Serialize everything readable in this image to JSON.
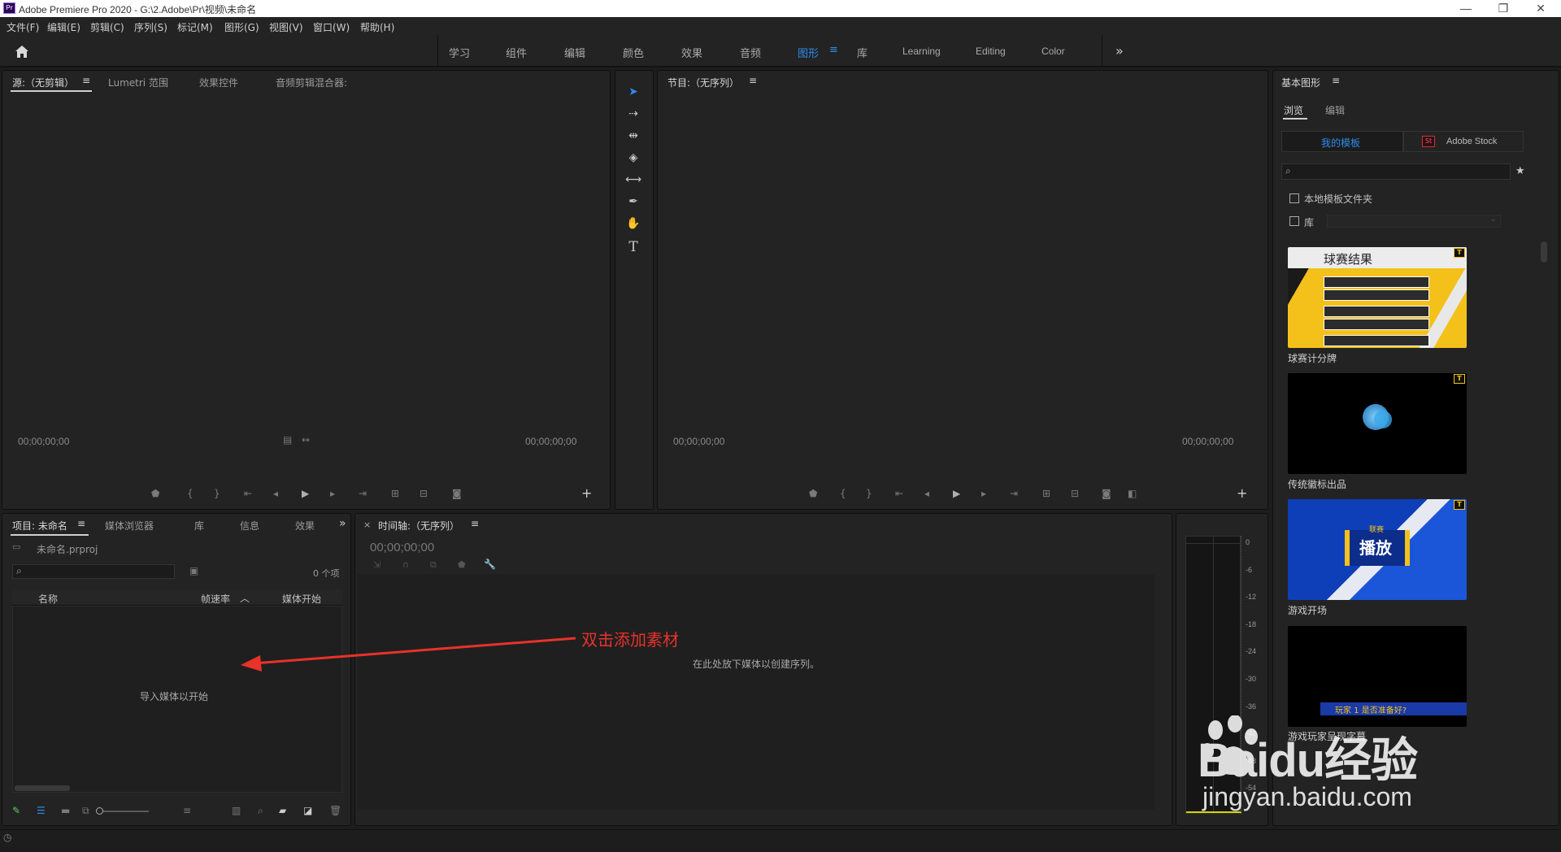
{
  "app": {
    "logo_text": "Pr",
    "title": "Adobe Premiere Pro 2020 - G:\\2.Adobe\\Pr\\视频\\未命名"
  },
  "window_controls": {
    "minimize": "—",
    "restore": "❐",
    "close": "✕"
  },
  "menu": [
    "文件(F)",
    "编辑(E)",
    "剪辑(C)",
    "序列(S)",
    "标记(M)",
    "图形(G)",
    "视图(V)",
    "窗口(W)",
    "帮助(H)"
  ],
  "workspaces": {
    "items": [
      "学习",
      "组件",
      "编辑",
      "颜色",
      "效果",
      "音频",
      "图形",
      "库",
      "Learning",
      "Editing",
      "Color"
    ],
    "active": "图形",
    "overflow": "»"
  },
  "source_panel": {
    "tabs": [
      "源:（无剪辑）",
      "Lumetri 范围",
      "效果控件",
      "音频剪辑混合器:"
    ],
    "timecode_left": "00;00;00;00",
    "timecode_right": "00;00;00;00"
  },
  "program_panel": {
    "title": "节目:（无序列）",
    "timecode_left": "00;00;00;00",
    "timecode_right": "00;00;00;00"
  },
  "tools": [
    "selection-tool",
    "track-select-tool",
    "ripple-edit-tool",
    "razor-tool",
    "slip-tool",
    "pen-tool",
    "hand-tool",
    "type-tool"
  ],
  "project_panel": {
    "tabs": [
      "项目: 未命名",
      "媒体浏览器",
      "库",
      "信息",
      "效果"
    ],
    "file": "未命名.prproj",
    "item_count": "0 个项",
    "columns": [
      "名称",
      "帧速率",
      "媒体开始"
    ],
    "empty_message": "导入媒体以开始"
  },
  "timeline_panel": {
    "title": "时间轴:（无序列）",
    "timecode": "00;00;00;00",
    "empty_message": "在此处放下媒体以创建序列。"
  },
  "annotation": {
    "text": "双击添加素材",
    "color": "#e8322a"
  },
  "meter": {
    "labels": [
      "0",
      "-6",
      "-12",
      "-18",
      "-24",
      "-30",
      "-36",
      "-42",
      "-48",
      "-54"
    ]
  },
  "graphics_panel": {
    "title": "基本图形",
    "tabs": [
      "浏览",
      "编辑"
    ],
    "subtabs": [
      "我的模板",
      "Adobe Stock"
    ],
    "stock_badge": "St",
    "checkbox_local": "本地模板文件夹",
    "checkbox_lib": "库",
    "templates": [
      {
        "label": "球赛计分牌",
        "thumb_title": "球赛结果"
      },
      {
        "label": "传统徽标出品",
        "thumb_title": ""
      },
      {
        "label": "游戏开场",
        "thumb_title": "播放",
        "thumb_small": "联赛"
      },
      {
        "label": "游戏玩家呈现字幕",
        "thumb_title": "玩家 1 是否准备好?"
      }
    ],
    "template_badge": "T"
  },
  "watermark": {
    "brand": "Baidu经验",
    "url": "jingyan.baidu.com"
  },
  "colors": {
    "accent": "#2d8ceb",
    "panel": "#232323",
    "background": "#1d1d1d"
  }
}
